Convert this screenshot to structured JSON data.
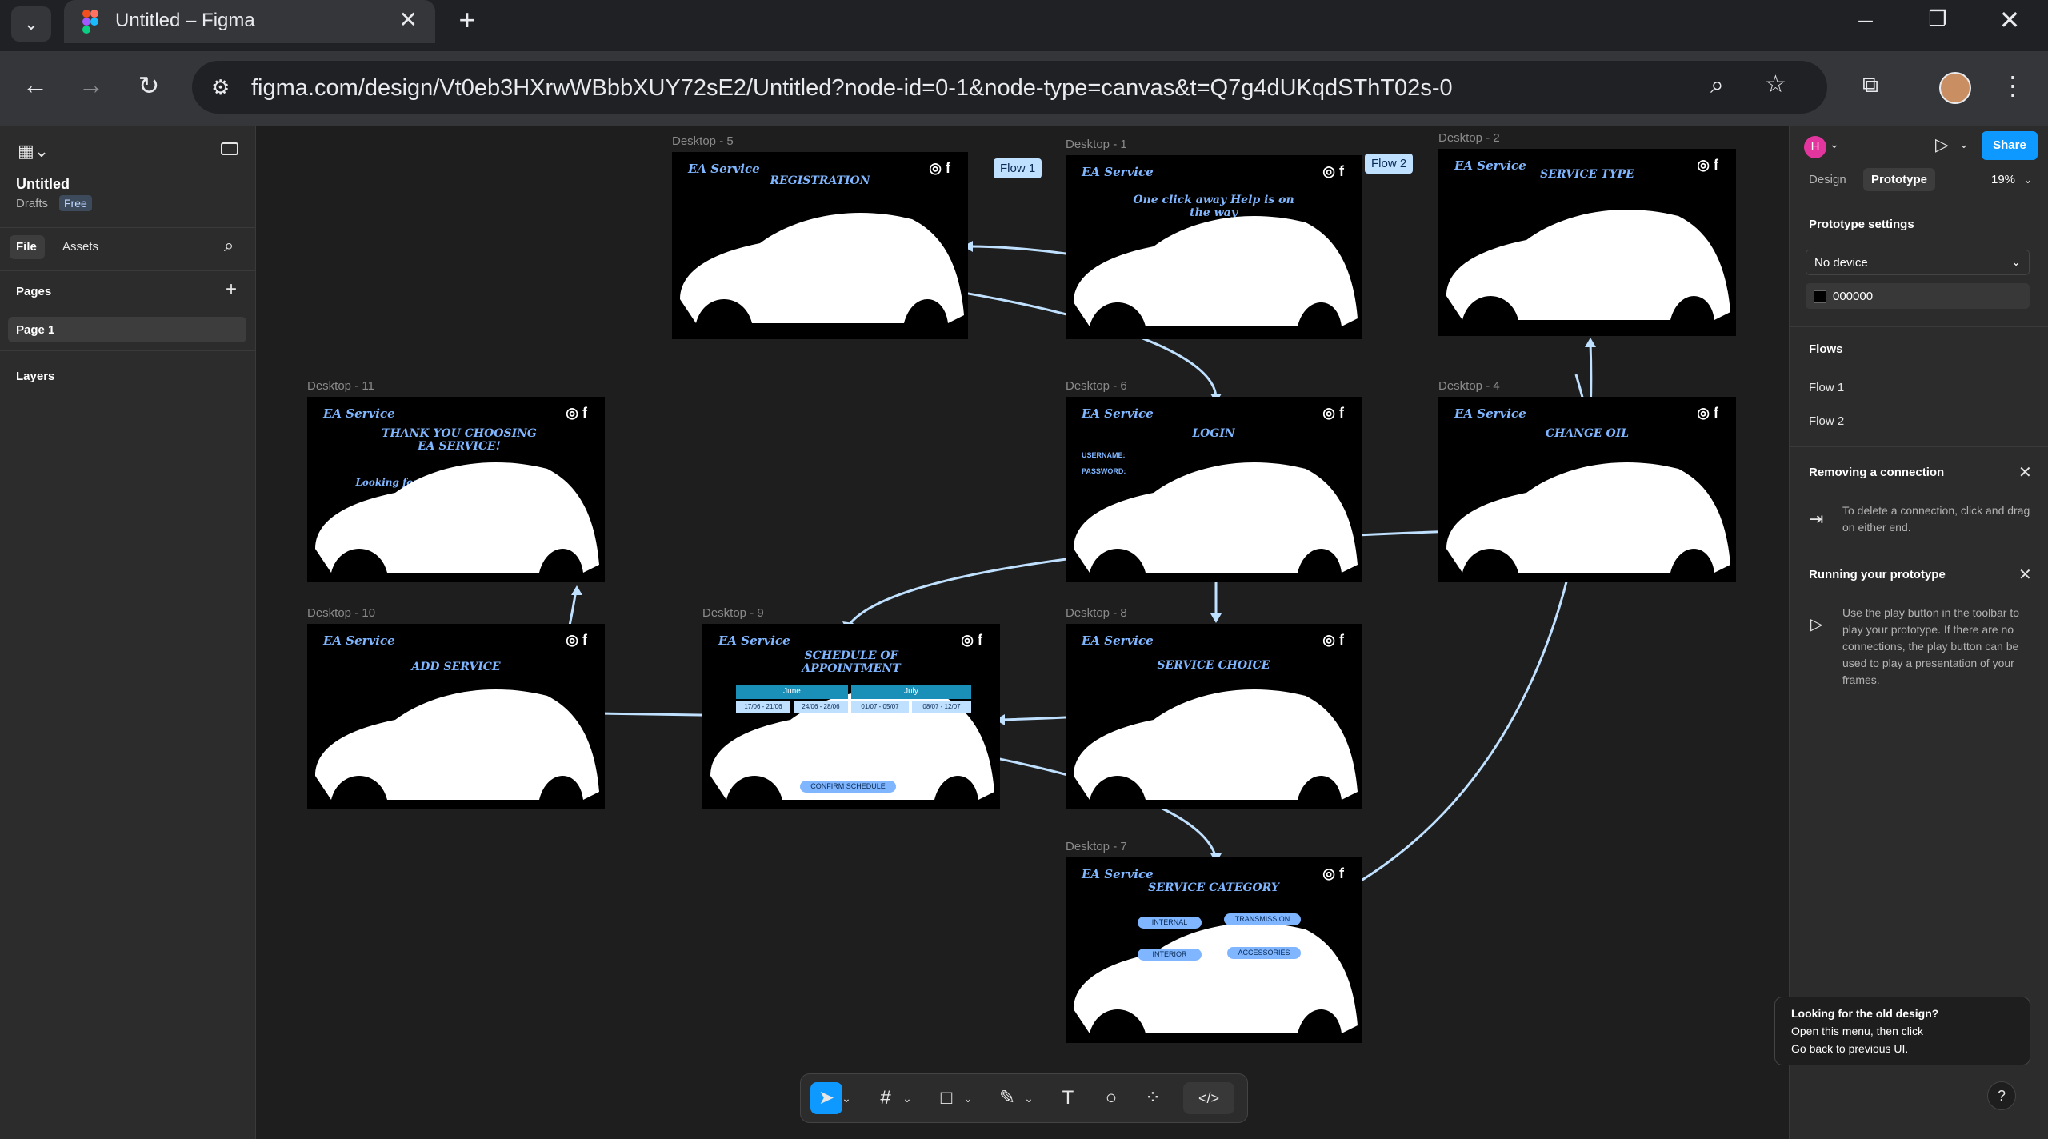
{
  "browser": {
    "tab_title": "Untitled – Figma",
    "url": "figma.com/design/Vt0eb3HXrwWBbbXUY72sE2/Untitled?node-id=0-1&node-type=canvas&t=Q7g4dUKqdSThT02s-0",
    "new_tab_glyph": "+",
    "close_glyph": "✕"
  },
  "left_panel": {
    "file_name": "Untitled",
    "location": "Drafts",
    "plan_badge": "Free",
    "tabs": [
      "File",
      "Assets"
    ],
    "pages_label": "Pages",
    "current_page": "Page 1",
    "layers_label": "Layers"
  },
  "right_panel": {
    "avatar_initial": "H",
    "tab_design": "Design",
    "tab_prototype": "Prototype",
    "zoom": "19%",
    "share_label": "Share",
    "prototype_settings_label": "Prototype settings",
    "device": "No device",
    "background_hex": "000000",
    "flows_label": "Flows",
    "flows": [
      "Flow 1",
      "Flow 2"
    ],
    "removing_title": "Removing a connection",
    "removing_text": "To delete a connection, click and drag on either end.",
    "running_title": "Running your prototype",
    "running_text": "Use the play button in the toolbar to play your prototype. If there are no connections, the play button can be used to play a presentation of your frames."
  },
  "notice": {
    "title": "Looking for the old design?",
    "line1": "Open this menu, then click",
    "line2": "Go back to previous UI."
  },
  "canvas": {
    "flow_tags": [
      "Flow 1",
      "Flow 2"
    ],
    "frames": [
      {
        "label": "Desktop - 5",
        "title": "REGISTRATION",
        "brand": "EA Service"
      },
      {
        "label": "Desktop - 1",
        "title": "One click away Help is on the way",
        "brand": "EA Service"
      },
      {
        "label": "Desktop - 2",
        "title": "SERVICE TYPE",
        "brand": "EA Service"
      },
      {
        "label": "Desktop - 11",
        "title": "THANK YOU CHOOSING EA SERVICE!",
        "subtitle": "Looking forward to seeing you again!",
        "brand": "EA Service"
      },
      {
        "label": "Desktop - 6",
        "title": "LOGIN",
        "brand": "EA Service"
      },
      {
        "label": "Desktop - 4",
        "title": "CHANGE OIL",
        "brand": "EA Service"
      },
      {
        "label": "Desktop - 10",
        "title": "ADD SERVICE",
        "brand": "EA Service"
      },
      {
        "label": "Desktop - 9",
        "title": "SCHEDULE OF APPOINTMENT",
        "brand": "EA Service"
      },
      {
        "label": "Desktop - 8",
        "title": "SERVICE CHOICE",
        "brand": "EA Service"
      },
      {
        "label": "Desktop - 7",
        "title": "SERVICE CATEGORY",
        "brand": "EA Service"
      }
    ],
    "schedule": {
      "months": [
        "June",
        "July"
      ],
      "weeks": [
        "17/06 - 21/06",
        "24/06 - 28/06",
        "01/07 - 05/07",
        "08/07 - 12/07"
      ],
      "confirm": "CONFIRM SCHEDULE"
    },
    "category_pills": [
      "INTERNAL",
      "TRANSMISSION",
      "INTERIOR",
      "ACCESSORIES"
    ],
    "login_fields": [
      "USERNAME:",
      "PASSWORD:"
    ]
  },
  "toolbar": {
    "icons": [
      "move-icon",
      "frame-icon",
      "rectangle-icon",
      "pen-icon",
      "text-icon",
      "comment-icon",
      "components-icon",
      "dev-mode-icon"
    ]
  },
  "help_glyph": "?"
}
